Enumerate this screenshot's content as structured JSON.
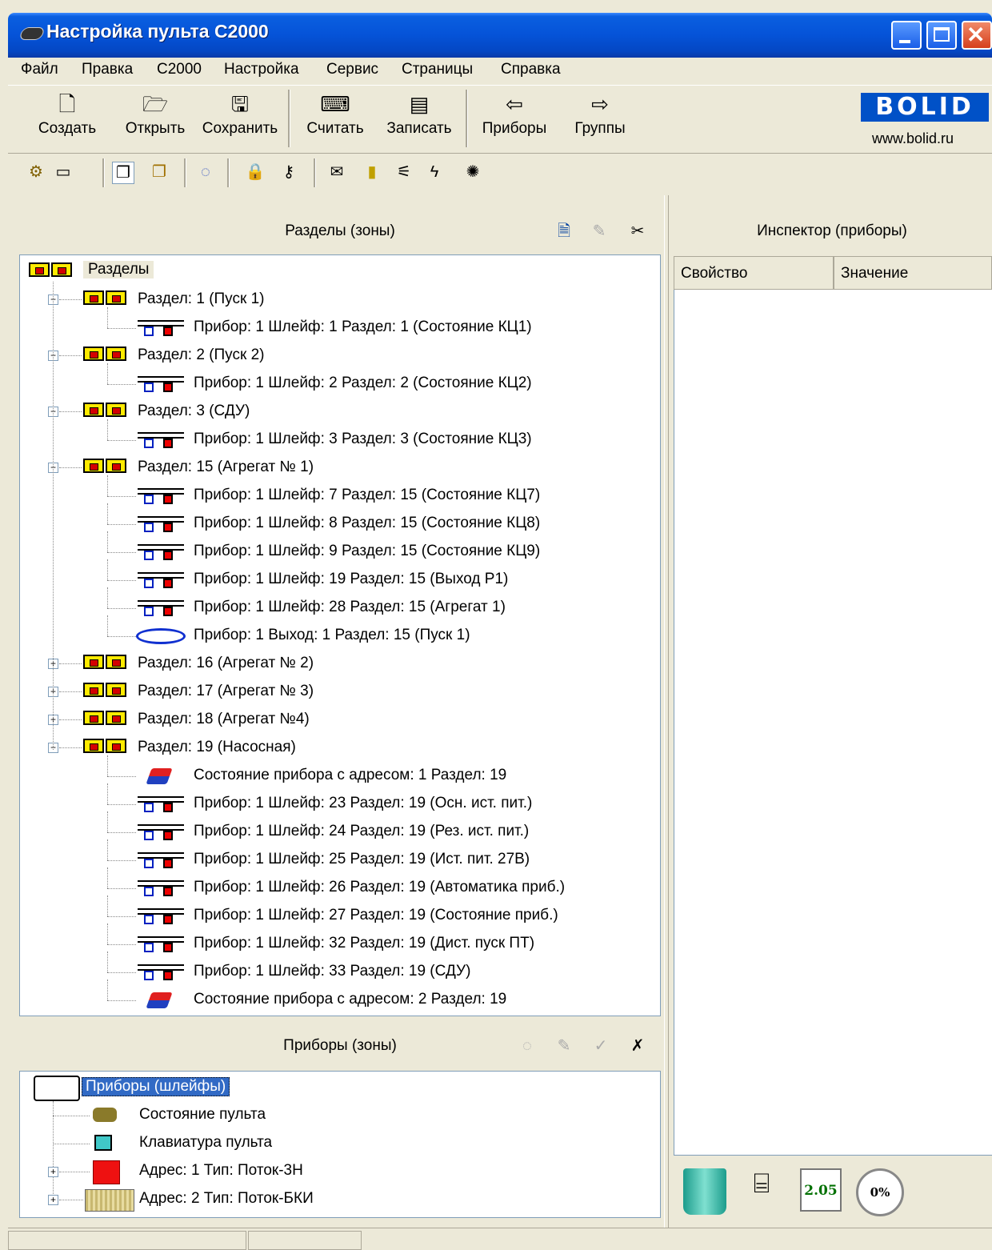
{
  "window": {
    "title": "Настройка пульта С2000"
  },
  "menu": [
    "Файл",
    "Правка",
    "С2000",
    "Настройка",
    "Сервис",
    "Страницы",
    "Справка"
  ],
  "toolbar": {
    "create": "Создать",
    "open": "Открыть",
    "save": "Сохранить",
    "read": "Считать",
    "write": "Записать",
    "devices": "Приборы",
    "groups": "Группы"
  },
  "brand": {
    "logo": "BOLID",
    "url": "www.bolid.ru",
    "color": "#0051c7"
  },
  "sections_panel": {
    "title": "Разделы (зоны)",
    "root": "Разделы",
    "items": [
      {
        "text": "Раздел: 1 (Пуск 1)",
        "type": "section",
        "expanded": true
      },
      {
        "text": "Прибор: 1 Шлейф: 1 Раздел: 1 (Состояние КЦ1)",
        "type": "loop"
      },
      {
        "text": "Раздел: 2 (Пуск 2)",
        "type": "section",
        "expanded": true
      },
      {
        "text": "Прибор: 1 Шлейф: 2 Раздел: 2 (Состояние КЦ2)",
        "type": "loop"
      },
      {
        "text": "Раздел: 3 (СДУ)",
        "type": "section",
        "expanded": true
      },
      {
        "text": "Прибор: 1 Шлейф: 3 Раздел: 3 (Состояние КЦ3)",
        "type": "loop"
      },
      {
        "text": "Раздел: 15 (Агрегат № 1)",
        "type": "section",
        "expanded": true
      },
      {
        "text": "Прибор: 1 Шлейф: 7 Раздел: 15 (Состояние КЦ7)",
        "type": "loop"
      },
      {
        "text": "Прибор: 1 Шлейф: 8 Раздел: 15 (Состояние КЦ8)",
        "type": "loop"
      },
      {
        "text": "Прибор: 1 Шлейф: 9 Раздел: 15 (Состояние КЦ9)",
        "type": "loop"
      },
      {
        "text": "Прибор: 1 Шлейф: 19 Раздел: 15 (Выход Р1)",
        "type": "loop"
      },
      {
        "text": "Прибор: 1 Шлейф: 28 Раздел: 15 (Агрегат 1)",
        "type": "loop"
      },
      {
        "text": "Прибор: 1 Выход: 1 Раздел: 15 (Пуск 1)",
        "type": "output"
      },
      {
        "text": "Раздел: 16 (Агрегат № 2)",
        "type": "section",
        "expanded": false
      },
      {
        "text": "Раздел: 17 (Агрегат № 3)",
        "type": "section",
        "expanded": false
      },
      {
        "text": "Раздел: 18 (Агрегат №4)",
        "type": "section",
        "expanded": false
      },
      {
        "text": "Раздел: 19 (Насосная)",
        "type": "section",
        "expanded": true
      },
      {
        "text": "Состояние прибора с адресом: 1 Раздел: 19",
        "type": "state"
      },
      {
        "text": "Прибор: 1 Шлейф: 23 Раздел: 19 (Осн. ист. пит.)",
        "type": "loop"
      },
      {
        "text": "Прибор: 1 Шлейф: 24 Раздел: 19 (Рез. ист. пит.)",
        "type": "loop"
      },
      {
        "text": "Прибор: 1 Шлейф: 25 Раздел: 19 (Ист. пит. 27В)",
        "type": "loop"
      },
      {
        "text": "Прибор: 1 Шлейф: 26 Раздел: 19 (Автоматика приб.)",
        "type": "loop"
      },
      {
        "text": "Прибор: 1 Шлейф: 27 Раздел: 19 (Состояние приб.)",
        "type": "loop"
      },
      {
        "text": "Прибор: 1 Шлейф: 32 Раздел: 19 (Дист. пуск ПТ)",
        "type": "loop"
      },
      {
        "text": "Прибор: 1 Шлейф: 33 Раздел: 19 (СДУ)",
        "type": "loop"
      },
      {
        "text": "Состояние прибора с адресом: 2 Раздел: 19",
        "type": "state"
      }
    ]
  },
  "devices_panel": {
    "title": "Приборы  (зоны)",
    "root": "Приборы (шлейфы)",
    "items": [
      {
        "text": "Состояние пульта"
      },
      {
        "text": "Клавиатура пульта"
      },
      {
        "text": "Адрес: 1 Тип: Поток-3Н"
      },
      {
        "text": "Адрес: 2 Тип: Поток-БКИ"
      }
    ]
  },
  "inspector": {
    "title": "Инспектор (приборы)",
    "col_property": "Свойство",
    "col_value": "Значение",
    "version": "2.05",
    "progress": "0%"
  }
}
